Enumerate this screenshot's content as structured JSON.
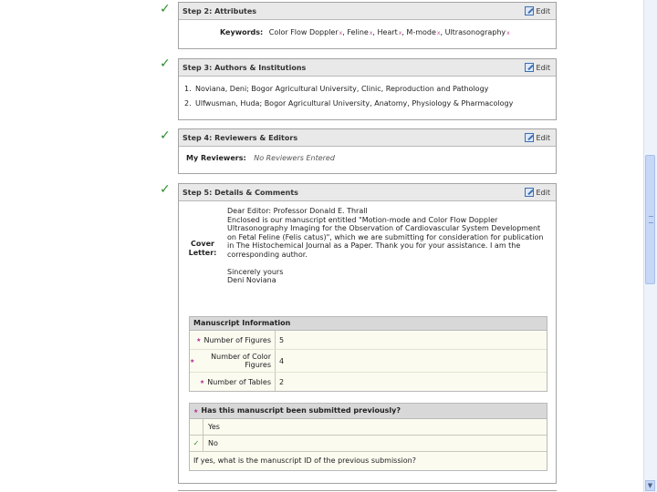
{
  "steps": {
    "attributes": {
      "title": "Step 2: Attributes",
      "edit_label": "Edit",
      "keywords_label": "Keywords:",
      "keywords": [
        "Color Flow Doppler",
        "Feline",
        "Heart",
        "M-mode",
        "Ultrasonography"
      ]
    },
    "authors": {
      "title": "Step 3: Authors & Institutions",
      "edit_label": "Edit",
      "items": [
        {
          "num": "1.",
          "text": "Noviana, Deni; Bogor Agricultural University, Clinic, Reproduction and Pathology"
        },
        {
          "num": "2.",
          "text": "Ulfwusman, Huda; Bogor Agricultural University, Anatomy, Physiology & Pharmacology"
        }
      ]
    },
    "reviewers": {
      "title": "Step 4: Reviewers & Editors",
      "edit_label": "Edit",
      "label": "My Reviewers:",
      "value": "No Reviewers Entered"
    },
    "details": {
      "title": "Step 5: Details & Comments",
      "edit_label": "Edit",
      "cover_label": "Cover Letter:",
      "cover_lines": [
        "Dear Editor: Professor Donald E. Thrall",
        "Enclosed is our manuscript entitled \"Motion-mode and Color Flow Doppler",
        "Ultrasonography Imaging for the Observation of Cardiovascular System Development",
        "on Fetal Feline (Felis catus)\", which we are submitting for consideration for publication",
        "in The Histochemical Journal as a Paper. Thank you for your assistance. I am the",
        "corresponding author.",
        "",
        "Sincerely yours",
        "Deni Noviana"
      ],
      "manuscript_info": {
        "title": "Manuscript Information",
        "rows": [
          {
            "label": "Number of Figures",
            "value": "5"
          },
          {
            "label": "Number of Color Figures",
            "value": "4"
          },
          {
            "label": "Number of Tables",
            "value": "2"
          }
        ]
      },
      "submitted_previously": {
        "question": "Has this manuscript been submitted previously?",
        "options": [
          {
            "label": "Yes",
            "selected": false
          },
          {
            "label": "No",
            "selected": true
          }
        ],
        "follow_up": "If yes, what is the manuscript ID of the previous submission?"
      }
    }
  },
  "colors": {
    "check": "#2f8f2f",
    "header_bg": "#e9e9e9",
    "required_marker": "#b02f8e"
  }
}
